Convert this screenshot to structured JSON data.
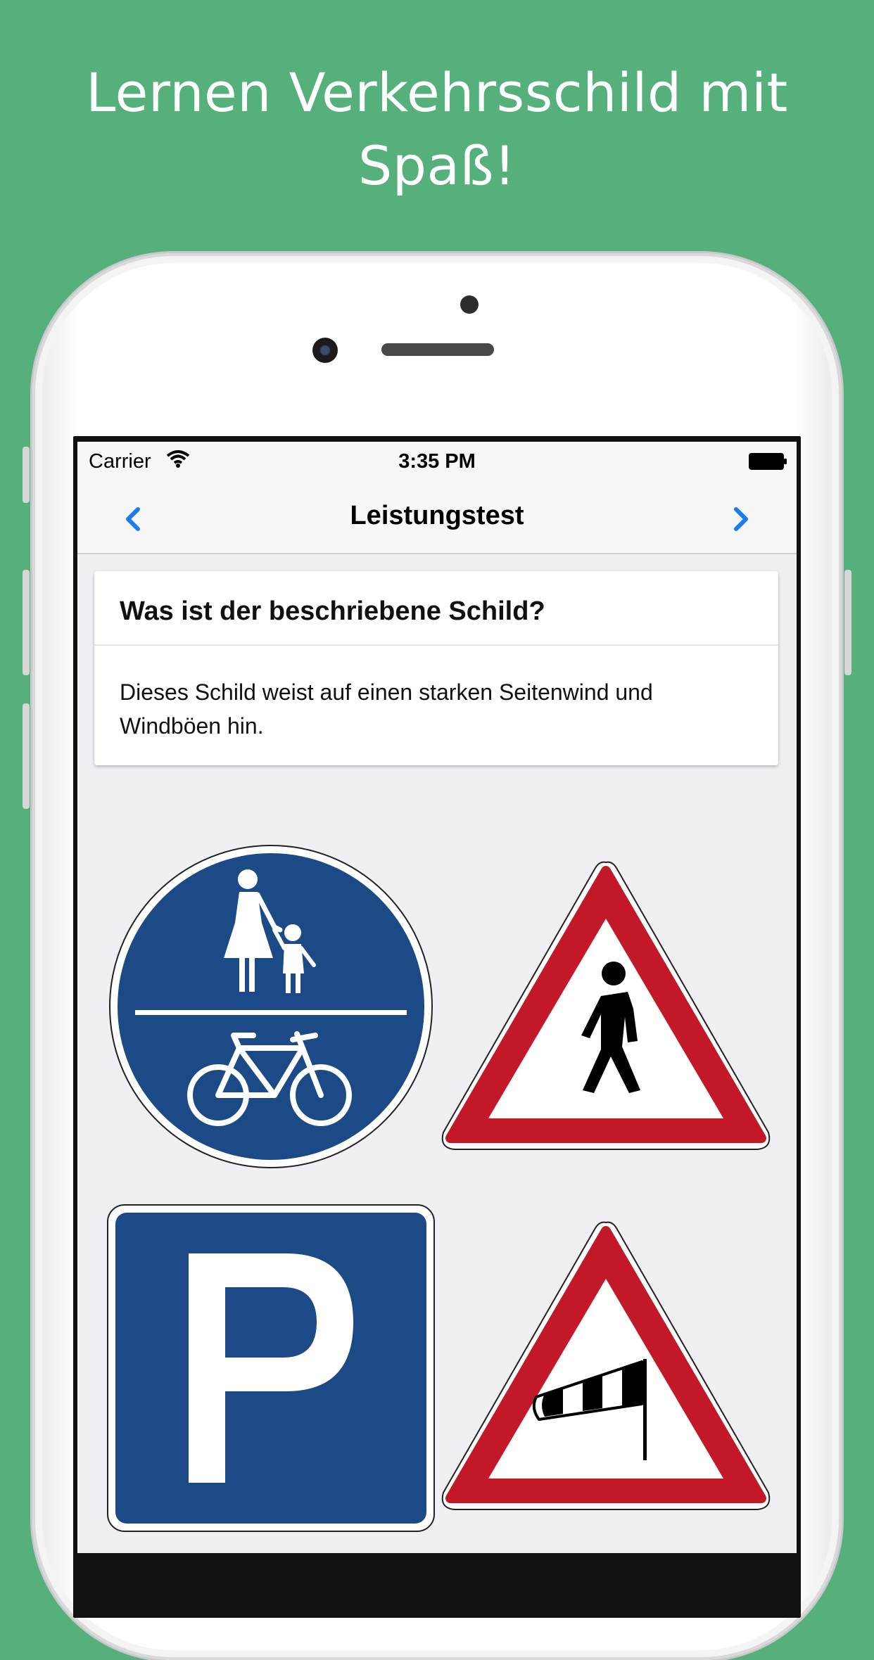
{
  "headline": "Lernen Verkehrsschild mit Spaß!",
  "status_bar": {
    "carrier": "Carrier",
    "time": "3:35 PM"
  },
  "nav": {
    "title": "Leistungstest",
    "back_icon": "chevron-left-icon",
    "forward_icon": "chevron-right-icon"
  },
  "question": {
    "title": "Was ist der beschriebene Schild?",
    "description": "Dieses Schild weist auf einen starken Seitenwind und Windböen hin."
  },
  "answer_options": [
    {
      "icon": "shared-pedestrian-bicycle-path-sign"
    },
    {
      "icon": "pedestrians-warning-sign"
    },
    {
      "icon": "parking-sign"
    },
    {
      "icon": "crosswind-warning-sign"
    }
  ],
  "colors": {
    "background": "#55b07c",
    "accent": "#1a7cf0",
    "sign_blue": "#1b4a86",
    "sign_red": "#c31827"
  }
}
